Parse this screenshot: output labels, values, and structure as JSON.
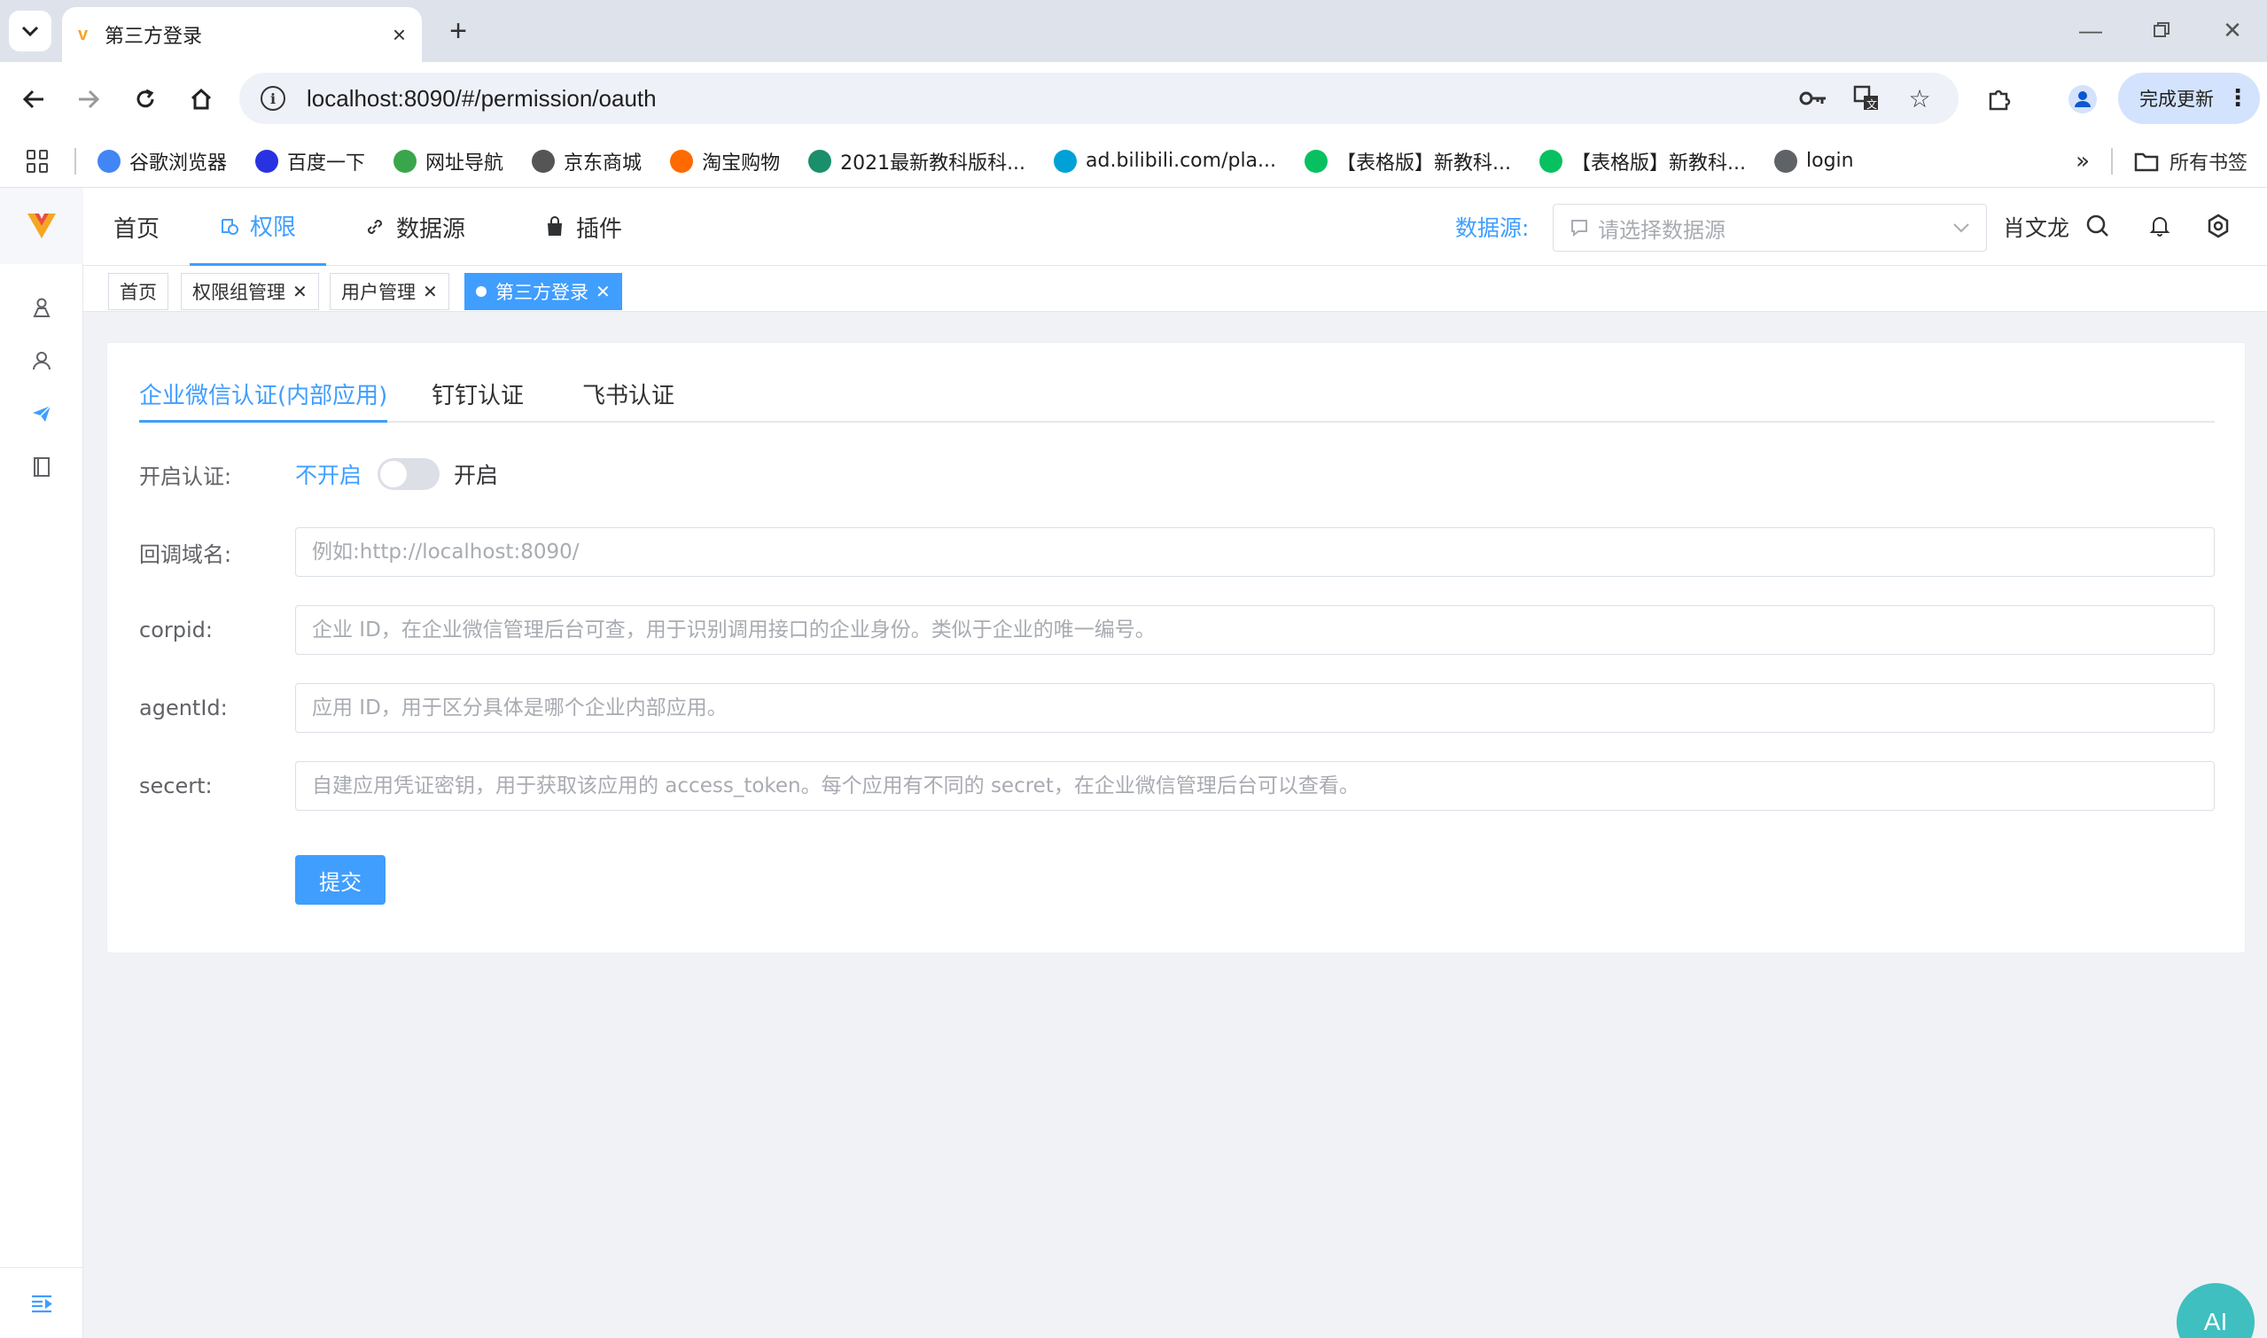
{
  "browser": {
    "tab_title": "第三方登录",
    "url": "localhost:8090/#/permission/oauth",
    "update_label": "完成更新",
    "bookmarks": [
      {
        "label": "谷歌浏览器",
        "color": "#4285f4"
      },
      {
        "label": "百度一下",
        "color": "#2932e1"
      },
      {
        "label": "网址导航",
        "color": "#3aa64c"
      },
      {
        "label": "京东商城",
        "color": "#555555"
      },
      {
        "label": "淘宝购物",
        "color": "#ff6a00"
      },
      {
        "label": "2021最新教科版科...",
        "color": "#1a8f6b"
      },
      {
        "label": "ad.bilibili.com/pla...",
        "color": "#00a1d6"
      },
      {
        "label": "【表格版】新教科...",
        "color": "#07c160"
      },
      {
        "label": "【表格版】新教科...",
        "color": "#07c160"
      },
      {
        "label": "login",
        "color": "#5f6368"
      }
    ],
    "all_bookmarks": "所有书签"
  },
  "nav": {
    "items": [
      "首页",
      "权限",
      "数据源",
      "插件"
    ],
    "datasource_label": "数据源:",
    "datasource_placeholder": "请选择数据源",
    "user": "肖文龙"
  },
  "tags": [
    "首页",
    "权限组管理",
    "用户管理",
    "第三方登录"
  ],
  "form": {
    "tabs": [
      "企业微信认证(内部应用)",
      "钉钉认证",
      "飞书认证"
    ],
    "enable_label": "开启认证:",
    "switch_off": "不开启",
    "switch_on": "开启",
    "fields": [
      {
        "label": "回调域名:",
        "placeholder": "例如:http://localhost:8090/"
      },
      {
        "label": "corpid:",
        "placeholder": "企业 ID，在企业微信管理后台可查，用于识别调用接口的企业身份。类似于企业的唯一编号。"
      },
      {
        "label": "agentId:",
        "placeholder": "应用 ID，用于区分具体是哪个企业内部应用。"
      },
      {
        "label": "secert:",
        "placeholder": "自建应用凭证密钥，用于获取该应用的 access_token。每个应用有不同的 secret，在企业微信管理后台可以查看。"
      }
    ],
    "submit": "提交"
  },
  "fab": "AI",
  "colors": {
    "primary": "#409eff",
    "fab": "#3fbfc0"
  }
}
